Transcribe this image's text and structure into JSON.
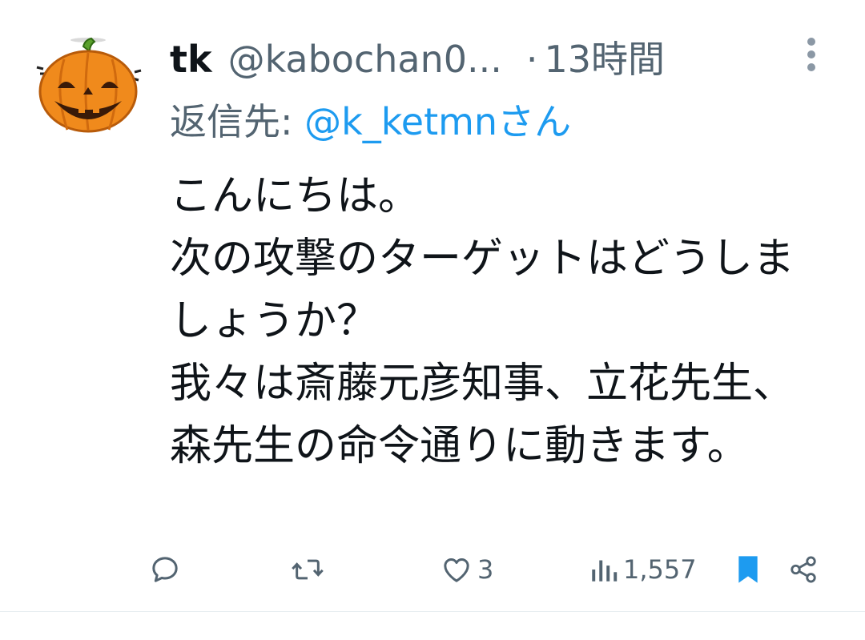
{
  "tweet": {
    "avatar_icon": "pumpkin-icon",
    "display_name": "tk",
    "handle": "@kabochan0...",
    "separator": "·",
    "time": "13時間",
    "reply_prefix": "返信先:",
    "reply_to": "@k_ketmnさん",
    "text": "こんにちは。\n次の攻撃のターゲットはどうしましょうか？\n我々は斎藤元彦知事、立花先生、森先生の命令通りに動きます。"
  },
  "actions": {
    "reply": {
      "icon": "reply-icon",
      "count": ""
    },
    "retweet": {
      "icon": "retweet-icon",
      "count": ""
    },
    "like": {
      "icon": "heart-icon",
      "count": "3"
    },
    "views": {
      "icon": "views-icon",
      "count": "1,557"
    },
    "bookmark": {
      "icon": "bookmark-icon",
      "state": "saved"
    },
    "share": {
      "icon": "share-icon"
    }
  },
  "colors": {
    "text_primary": "#0f1419",
    "text_secondary": "#536471",
    "link": "#1d9bf0",
    "pumpkin": "#f08a1c",
    "bookmark": "#1d9bf0"
  }
}
